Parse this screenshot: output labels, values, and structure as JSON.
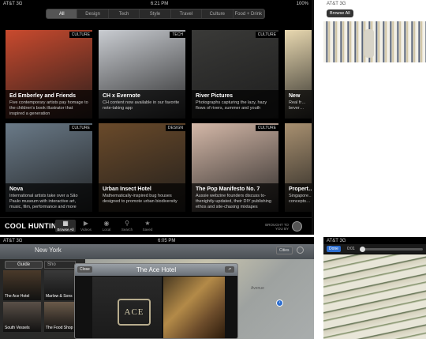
{
  "status": {
    "carrier": "AT&T",
    "network": "3G",
    "time": "6:21 PM",
    "battery": "100%"
  },
  "tabs": [
    {
      "label": "All",
      "active": true
    },
    {
      "label": "Design",
      "active": false
    },
    {
      "label": "Tech",
      "active": false
    },
    {
      "label": "Style",
      "active": false
    },
    {
      "label": "Travel",
      "active": false
    },
    {
      "label": "Culture",
      "active": false
    },
    {
      "label": "Food + Drink",
      "active": false
    }
  ],
  "tiles": [
    {
      "category": "CULTURE",
      "title": "Ed Emberley and Friends",
      "desc": "Five contemporary artists pay homage to the children's book illustrator that inspired a generation",
      "color": "#c94a2e"
    },
    {
      "category": "TECH",
      "title": "CH x Evernote",
      "desc": "CH content now available in our favorite note-taking app",
      "color": "#c9ccd1"
    },
    {
      "category": "CULTURE",
      "title": "River Pictures",
      "desc": "Photographs capturing the lazy, hazy flows of rivers, summer and youth",
      "color": "#3a3a38"
    },
    {
      "category": "",
      "title": "New",
      "desc": "Real fr… bever…",
      "color": "#e8d8b0"
    },
    {
      "category": "CULTURE",
      "title": "Nova",
      "desc": "International artists take over a São Paulo museum with interactive art, music, film, performance and more",
      "color": "#6a7a88"
    },
    {
      "category": "DESIGN",
      "title": "Urban Insect Hotel",
      "desc": "Mathematically-inspired bug houses designed to promote urban biodiversity",
      "color": "#6a4a2a"
    },
    {
      "category": "CULTURE",
      "title": "The Pop Manifesto No. 7",
      "desc": "Aussie webzine founders discuss to-thenightly-updated, their DIY publishing ethos and site-chasing mixtapes",
      "color": "#d4b8a8"
    },
    {
      "category": "",
      "title": "Propert…",
      "desc": "Singapore… concepts…",
      "color": "#a89070"
    }
  ],
  "toolbar": {
    "logo": "COOL HUNTING",
    "items": [
      {
        "label": "Browse All",
        "icon": "grid-icon",
        "glyph": "▦",
        "active": true
      },
      {
        "label": "Videos",
        "icon": "video-icon",
        "glyph": "▶",
        "active": false
      },
      {
        "label": "Local",
        "icon": "local-icon",
        "glyph": "◉",
        "active": false
      },
      {
        "label": "Search",
        "icon": "search-icon",
        "glyph": "⚲",
        "active": false
      },
      {
        "label": "Saved",
        "icon": "star-icon",
        "glyph": "★",
        "active": false
      }
    ],
    "brought": "BROUGHT TO YOU BY"
  },
  "panel2": {
    "carrier": "AT&T",
    "network": "3G",
    "browse": "Browse All"
  },
  "map": {
    "status_carrier": "AT&T",
    "status_network": "3G",
    "status_time": "6:05 PM",
    "city": "New York",
    "cities_btn": "Cities",
    "guide_tabs": [
      "Guide",
      "Sho"
    ],
    "side_items": [
      "The Ace Hotel",
      "Marlow & Sons",
      "South Vessels",
      "The Food Shop"
    ],
    "modal_close": "Close",
    "modal_title": "The Ace Hotel",
    "ace_sign": "ACE",
    "street_label": "Avenue"
  },
  "video": {
    "carrier": "AT&T",
    "network": "3G",
    "done": "Done",
    "time": "0:01"
  }
}
